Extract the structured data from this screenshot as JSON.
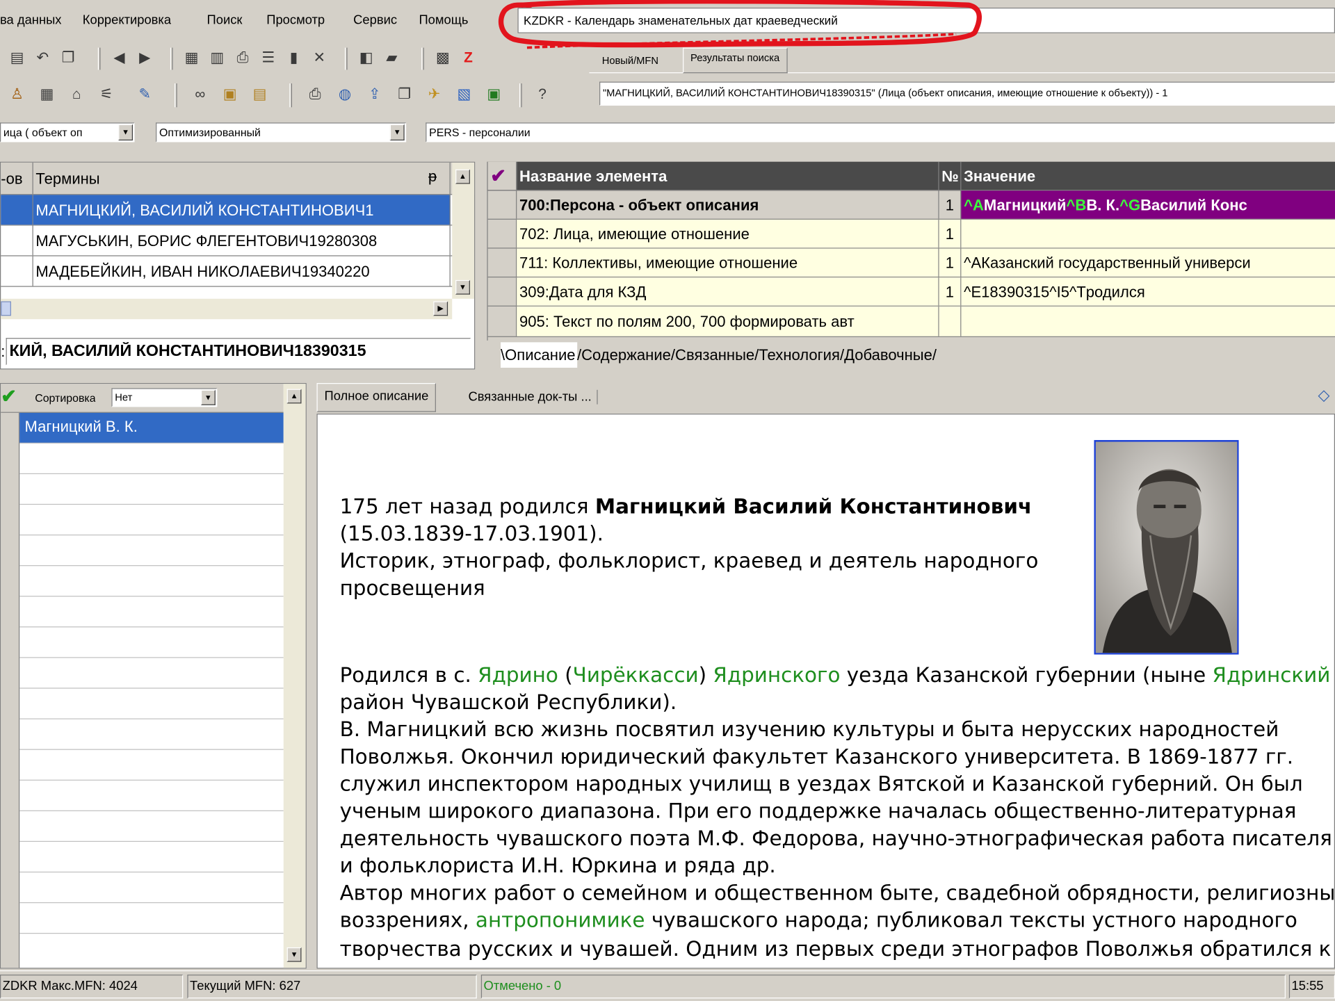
{
  "menu": [
    "ва данных",
    "Корректировка",
    "Поиск",
    "Просмотр",
    "Сервис",
    "Помощь"
  ],
  "db_title": "KZDKR - Календарь знаменательных дат краеведческий",
  "tabs_top": [
    "Новый/MFN",
    "Результаты поиска"
  ],
  "search_result": "\"МАГНИЦКИЙ, ВАСИЛИЙ КОНСТАНТИНОВИЧ18390315\" (Лица (объект описания, имеющие отношение к объекту)) - 1",
  "combos": {
    "prefix": "ица ( объект оп",
    "mode": "Оптимизированный",
    "worksheet": "PERS - персоналии"
  },
  "terms": {
    "col_count": "-ов",
    "col_terms": "Термины",
    "pin": "ᵽ",
    "items": [
      "МАГНИЦКИЙ, ВАСИЛИЙ КОНСТАНТИНОВИЧ1",
      "МАГУСЬКИН, БОРИС ФЛЕГЕНТОВИЧ19280308",
      "МАДЕБЕЙКИН, ИВАН НИКОЛАЕВИЧ19340220"
    ],
    "input_label": ":",
    "input": "КИЙ, ВАСИЛИЙ КОНСТАНТИНОВИЧ18390315"
  },
  "fields": {
    "check": "✔",
    "head_name": "Название элемента",
    "head_num": "№",
    "head_val": "Значение",
    "rows": [
      {
        "name": "700:Персона - объект описания",
        "num": "1",
        "parts": [
          "^A",
          "Магницкий",
          "^B",
          "В. К.",
          "^G",
          "Василий Конс"
        ]
      },
      {
        "name": "702: Лица, имеющие отношение",
        "num": "1",
        "val": ""
      },
      {
        "name": "711: Коллективы, имеющие отношение",
        "num": "1",
        "val": "^AКазанский государственный универси"
      },
      {
        "name": "309:Дата для КЗД",
        "num": "1",
        "val": "^E18390315^I5^Tродился"
      },
      {
        "name": "905: Текст по полям 200, 700 формировать авт",
        "num": "",
        "val": ""
      }
    ],
    "tabs": [
      "\\Описание",
      "/Содержание",
      "/Связанные",
      "/Технология",
      "/Добавочные/"
    ]
  },
  "results": {
    "check": "✔",
    "sort_label": "Сортировка",
    "sort_value": "Нет",
    "items": [
      "Магницкий В. К."
    ]
  },
  "doc_tabs": [
    "Полное описание",
    "Связанные док-ты ..."
  ],
  "doc": {
    "p1_pre": "175 лет назад родился ",
    "p1_bold": "Магницкий Василий Константинович",
    "p1_dates": "(15.03.1839-17.03.1901).",
    "p1_desc": "Историк, этнограф, фольклорист, краевед и деятель народного",
    "p1_desc2": "просвещения",
    "p2": [
      [
        "Родился в с. ",
        ""
      ],
      [
        "Ядрино",
        "g"
      ],
      [
        " (",
        ""
      ],
      [
        "Чирёккасси",
        "g"
      ],
      [
        ") ",
        ""
      ],
      [
        "Ядринского",
        "g"
      ],
      [
        " уезда Казанской губернии (ныне ",
        ""
      ],
      [
        "Ядринский",
        "g"
      ]
    ],
    "p2b": "район Чувашской Республики).",
    "lines": [
      "В. Магницкий всю жизнь посвятил изучению культуры и быта нерусских народностей",
      "Поволжья. Окончил юридический факультет Казанского университета. В 1869-1877 гг.",
      "служил инспектором народных училищ в уездах Вятской и Казанской губерний. Он был",
      "ученым широкого диапазона. При его поддержке началась общественно-литературная",
      "деятельность чувашского поэта М.Ф. Федорова, научно-этнографическая работа писателя",
      "и фольклориста И.Н. Юркина и ряда др.",
      "Автор многих работ о семейном и общественном быте, свадебной обрядности, религиозных"
    ],
    "l_last_pre": "воззрениях, ",
    "l_last_link": "антропонимике",
    "l_last_post": " чувашского народа; публиковал тексты устного народного",
    "l_cut": "творчества русских и чувашей. Одним из первых среди этнографов Поволжья обратился к"
  },
  "status": {
    "max": "ZDKR Макс.MFN: 4024",
    "cur": "Текущий MFN: 627",
    "marked": "Отмечено - 0",
    "time": "15:55"
  },
  "colors": {
    "purple": "#800080",
    "selection": "#316ac5",
    "link": "#1e8e1e",
    "field_bg": "#ffffe1"
  }
}
